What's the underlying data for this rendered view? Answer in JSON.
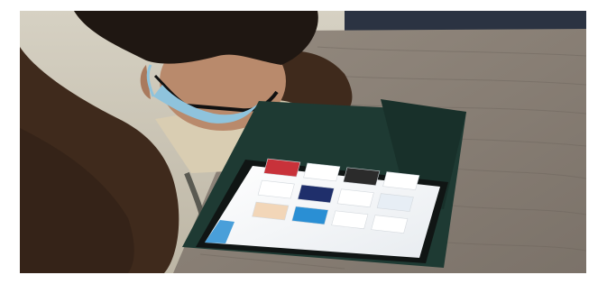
{
  "scene": {
    "description_kind": "photo",
    "subject": "person-using-tablet",
    "colors": {
      "table": "#8a8178",
      "table_dark": "#6e665e",
      "wall": "#c9c3b3",
      "sweater": "#3f2a1c",
      "skin": "#b98a6c",
      "hair": "#1f1712",
      "mask": "#8fc3dc",
      "case": "#1e3a33",
      "screen": "#f4f6f8",
      "accent_blue": "#2a8fd4",
      "accent_red": "#c8323a"
    }
  },
  "screen_tiles": [
    {
      "label": "",
      "color": "#c8323a"
    },
    {
      "label": "",
      "color": "#ffffff"
    },
    {
      "label": "",
      "color": "#2b2b2b"
    },
    {
      "label": "",
      "color": "#ffffff"
    },
    {
      "label": "",
      "color": "#ffffff"
    },
    {
      "label": "",
      "color": "#1f2f6b"
    },
    {
      "label": "",
      "color": "#ffffff"
    },
    {
      "label": "",
      "color": "#e7eef5"
    },
    {
      "label": "",
      "color": "#f2d6b8"
    },
    {
      "label": "",
      "color": "#2a8fd4"
    },
    {
      "label": "",
      "color": "#ffffff"
    },
    {
      "label": "",
      "color": "#ffffff"
    }
  ]
}
